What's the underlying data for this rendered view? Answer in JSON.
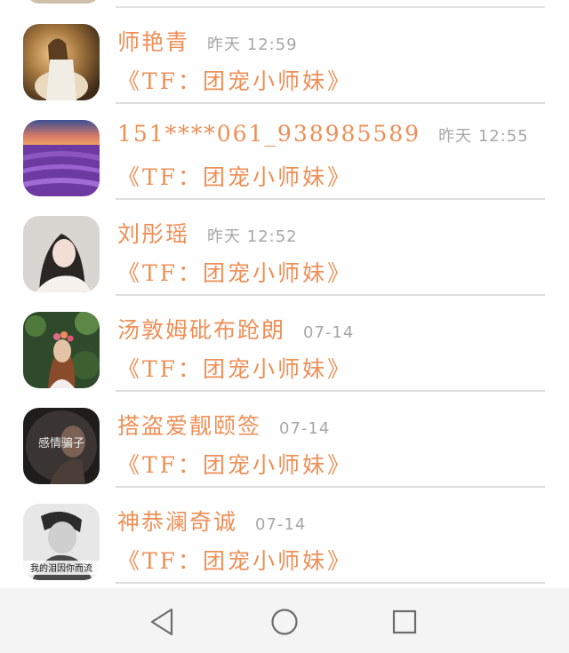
{
  "conversations": [
    {
      "name": "师艳青",
      "time": "昨天 12:59",
      "message": "《TF：团宠小师妹》",
      "avatar": "sunset-girl-icon"
    },
    {
      "name": "151****061_938985589",
      "time": "昨天 12:55",
      "message": "《TF：团宠小师妹》",
      "avatar": "lavender-field-icon"
    },
    {
      "name": "刘彤瑶",
      "time": "昨天 12:52",
      "message": "《TF：团宠小师妹》",
      "avatar": "portrait-girl-icon"
    },
    {
      "name": "汤敦姆砒布跄朗",
      "time": "07-14",
      "message": "《TF：团宠小师妹》",
      "avatar": "flower-crown-girl-icon"
    },
    {
      "name": "搭盗爱靓颐签",
      "time": "07-14",
      "message": "《TF：团宠小师妹》",
      "avatar": "dark-caption-photo-icon"
    },
    {
      "name": "神恭澜奇诚",
      "time": "07-14",
      "message": "《TF：团宠小师妹》",
      "avatar": "bw-portrait-icon"
    }
  ],
  "avatar_captions": {
    "row5": "感情骗子",
    "row6": "我的泪因你而流"
  },
  "navbar": {
    "back": "back-triangle-icon",
    "home": "home-circle-icon",
    "recents": "recents-square-icon"
  },
  "colors": {
    "accent": "#ee8f57",
    "time": "#a7a7a7",
    "separator": "#dddddd",
    "navbar_bg": "#f4f4f4"
  }
}
